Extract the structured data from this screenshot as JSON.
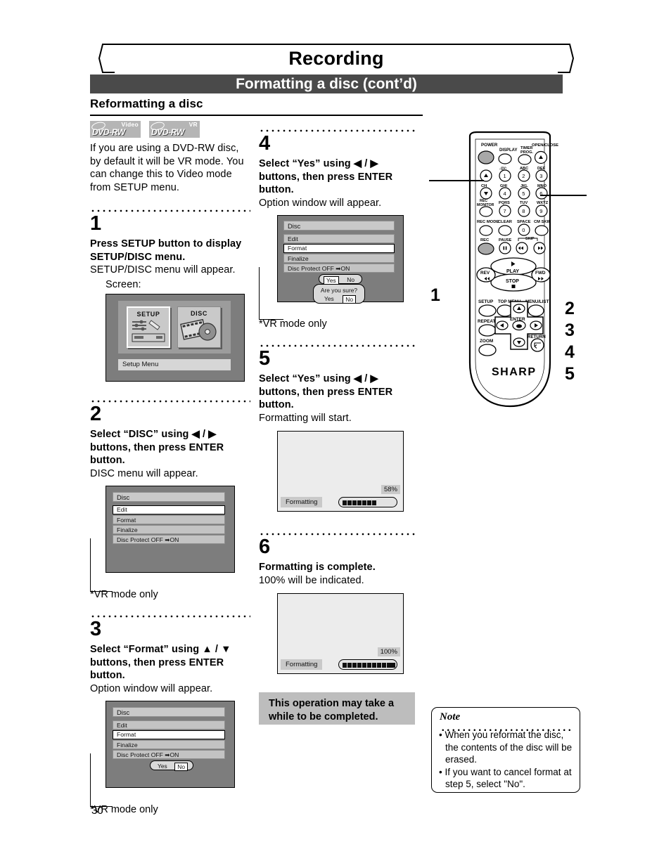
{
  "header": {
    "chapter": "Recording",
    "section": "Formatting a disc (cont’d)",
    "subsection": "Reformatting a disc"
  },
  "page_number": "30",
  "badges": [
    {
      "main": "DVD-RW",
      "mode": "Video"
    },
    {
      "main": "DVD-RW",
      "mode": "VR"
    }
  ],
  "intro": "If you are using a DVD-RW disc, by default it will be VR mode. You can change this to Video mode from SETUP menu.",
  "vr_note": "*VR mode only",
  "steps": [
    {
      "number": "1",
      "heading": "Press SETUP button to display SETUP/DISC menu.",
      "sub": "SETUP/DISC menu will appear.",
      "screen_caption": "Screen:"
    },
    {
      "number": "2",
      "heading": "Select “DISC” using ◀ / ▶ buttons, then press ENTER button.",
      "sub": "DISC menu will appear."
    },
    {
      "number": "3",
      "heading": "Select “Format” using ▲ / ▼ buttons, then press ENTER button.",
      "sub": "Option window will appear."
    },
    {
      "number": "4",
      "heading": "Select “Yes” using ◀ / ▶ buttons, then press ENTER button.",
      "sub": "Option window will appear."
    },
    {
      "number": "5",
      "heading": "Select “Yes” using ◀ / ▶ buttons, then press ENTER button.",
      "sub": "Formatting will start."
    },
    {
      "number": "6",
      "heading": "Formatting is complete.",
      "sub": "100% will be indicated."
    }
  ],
  "setup_disc_screen": {
    "tile_setup": "SETUP",
    "tile_disc": "DISC",
    "label": "Setup Menu"
  },
  "disc_menu": {
    "title": "Disc",
    "items": [
      "Edit",
      "Format",
      "Finalize",
      "Disc Protect OFF ➡ON"
    ],
    "selected_step2": "Edit",
    "selected_step3": "Format",
    "selected_step4": "Format"
  },
  "option_window": {
    "yes": "Yes",
    "no": "No",
    "step3_selected": "No",
    "step4_selected": "Yes",
    "confirm_question": "Are you sure?",
    "confirm_selected": "No"
  },
  "formatting_screens": [
    {
      "label": "Formatting",
      "percent": "58%",
      "filled": 7,
      "total": 11
    },
    {
      "label": "Formatting",
      "percent": "100%",
      "filled": 11,
      "total": 11
    }
  ],
  "gray_info": "This operation may take a while to be completed.",
  "note": {
    "title": "Note",
    "items": [
      "When you reformat the disc, the contents of the disc will be erased.",
      "If you want to cancel format at step 5, select \"No\"."
    ]
  },
  "remote": {
    "brand": "SHARP",
    "buttons": {
      "power": "POWER",
      "display": "DISPLAY",
      "timer_prog": "TIMER\nPROG.",
      "open_close": "OPEN/CLOSE",
      "ch": "CH",
      "rec_monitor": "REC\nMONITOR",
      "rec_mode": "REC MODE",
      "clear": "CLEAR",
      "space": "SPACE",
      "cm_skip": "CM SKIP",
      "rec": "REC",
      "pause": "PAUSE",
      "skip": "SKIP",
      "rev": "REV",
      "play": "PLAY",
      "fwd": "FWD",
      "stop": "STOP",
      "setup": "SETUP",
      "top_menu": "TOP MENU",
      "menu_list": "MENU/LIST",
      "repeat": "REPEAT",
      "enter": "ENTER",
      "zoom": "ZOOM",
      "return": "RETURN"
    },
    "keypad": [
      {
        "num": "1",
        "letters": ".@/:"
      },
      {
        "num": "2",
        "letters": "ABC"
      },
      {
        "num": "3",
        "letters": "DEF"
      },
      {
        "num": "4",
        "letters": "GHI"
      },
      {
        "num": "5",
        "letters": "JKL"
      },
      {
        "num": "6",
        "letters": "MNO"
      },
      {
        "num": "7",
        "letters": "PQRS"
      },
      {
        "num": "8",
        "letters": "TUV"
      },
      {
        "num": "9",
        "letters": "WXYZ"
      },
      {
        "num": "0",
        "letters": ""
      }
    ],
    "callouts": [
      "1",
      "2",
      "3",
      "4",
      "5"
    ]
  }
}
